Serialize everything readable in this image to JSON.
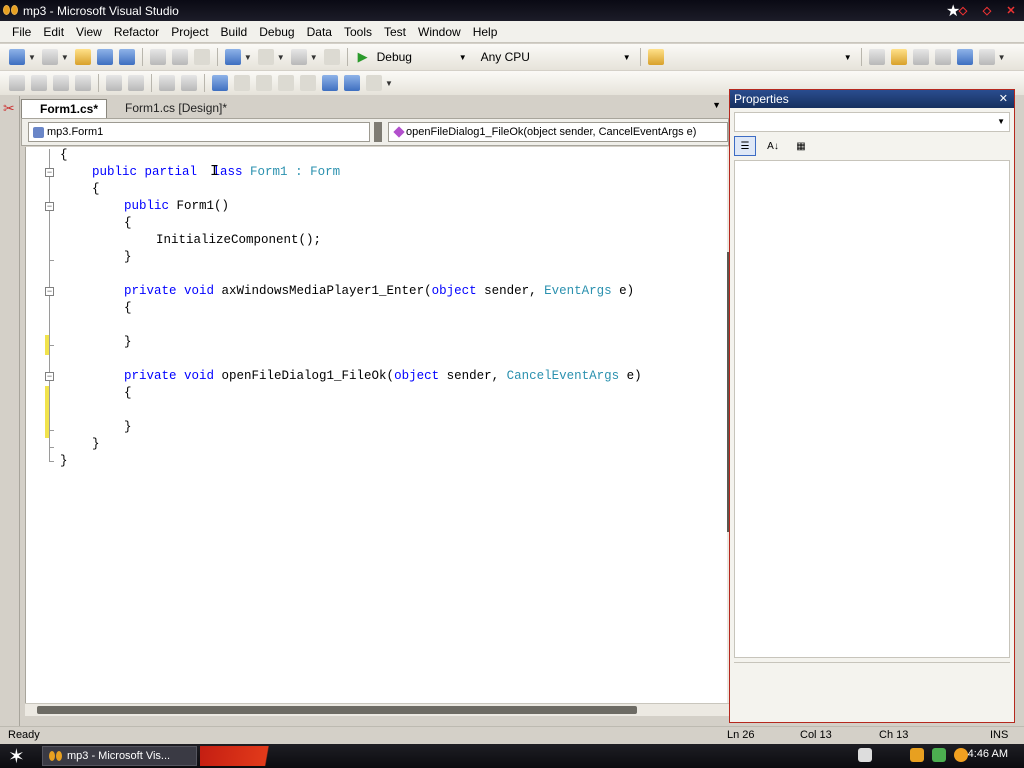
{
  "window": {
    "title": "mp3 - Microsoft Visual Studio"
  },
  "menu": [
    "File",
    "Edit",
    "View",
    "Refactor",
    "Project",
    "Build",
    "Debug",
    "Data",
    "Tools",
    "Test",
    "Window",
    "Help"
  ],
  "toolbar": {
    "config": "Debug",
    "platform": "Any CPU"
  },
  "tabs": [
    {
      "label": "Form1.cs*",
      "active": true
    },
    {
      "label": "Form1.cs [Design]*",
      "active": false
    }
  ],
  "navbar": {
    "class_combo": "mp3.Form1",
    "member_combo": "openFileDialog1_FileOk(object sender, CancelEventArgs e)"
  },
  "code": {
    "l1": "{",
    "l2_kw": "public partial ",
    "l2_kw2": "lass ",
    "l2_ty": "Form1",
    "l2_sep": " : ",
    "l2_ty2": "Form",
    "l3": "{",
    "l4_kw": "public ",
    "l4_tx": "Form1()",
    "l5": "{",
    "l6": "InitializeComponent();",
    "l7": "}",
    "l9_kw": "private void ",
    "l9_tx": "axWindowsMediaPlayer1_Enter(",
    "l9_kw2": "object ",
    "l9_tx2": "sender, ",
    "l9_ty": "EventArgs",
    "l9_tx3": " e)",
    "l10": "{",
    "l12": "}",
    "l14_kw": "private void ",
    "l14_tx": "openFileDialog1_FileOk(",
    "l14_kw2": "object ",
    "l14_tx2": "sender, ",
    "l14_ty": "CancelEventArgs",
    "l14_tx3": " e)",
    "l15": "{",
    "l17": "}",
    "l18": "}",
    "l19": "}"
  },
  "properties": {
    "title": "Properties"
  },
  "status": {
    "text": "Ready",
    "ln": "Ln 26",
    "col": "Col 13",
    "ch": "Ch 13",
    "mode": "INS"
  },
  "taskbar": {
    "task": "mp3 - Microsoft Vis...",
    "clock": "4:46 AM"
  },
  "colors": {
    "keyword": "#0000ff",
    "type": "#2b91af",
    "accent": "#b5281e"
  }
}
